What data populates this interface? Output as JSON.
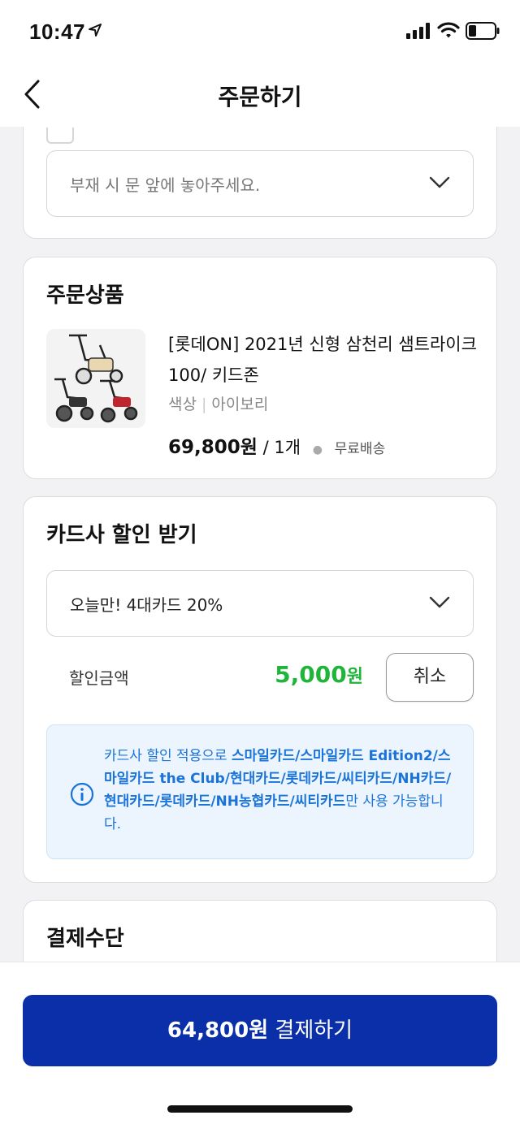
{
  "status_bar": {
    "time": "10:47"
  },
  "header": {
    "title": "주문하기"
  },
  "delivery": {
    "request_placeholder": "부재 시 문 앞에 놓아주세요."
  },
  "order_product": {
    "section_title": "주문상품",
    "name": "[롯데ON] 2021년 신형 삼천리 샘트라이크 100/ 키드존",
    "option_label": "색상",
    "option_value": "아이보리",
    "price": "69,800",
    "price_unit": "원",
    "quantity": "/ 1개",
    "shipping": "무료배송"
  },
  "card_discount": {
    "section_title": "카드사 할인 받기",
    "selected_option": "오늘만! 4대카드 20%",
    "discount_label": "할인금액",
    "discount_amount": "5,000",
    "discount_unit": "원",
    "cancel_label": "취소",
    "notice_prefix": "카드사 할인 적용으로 ",
    "notice_cards": "스마일카드/스마일카드 Edition2/스마일카드 the Club/현대카드/롯데카드/씨티카드/NH카드/현대카드/롯데카드/NH농협카드/씨티카드",
    "notice_suffix": "만 사용 가능합니다."
  },
  "payment_method": {
    "section_title": "결제수단"
  },
  "bottom": {
    "total_amount": "64,800원",
    "pay_label": " 결제하기"
  },
  "colors": {
    "primary_button": "#0a2fa8",
    "discount_green": "#1fb53b",
    "notice_blue": "#1a73d9",
    "notice_bg": "#ecf5fd"
  }
}
